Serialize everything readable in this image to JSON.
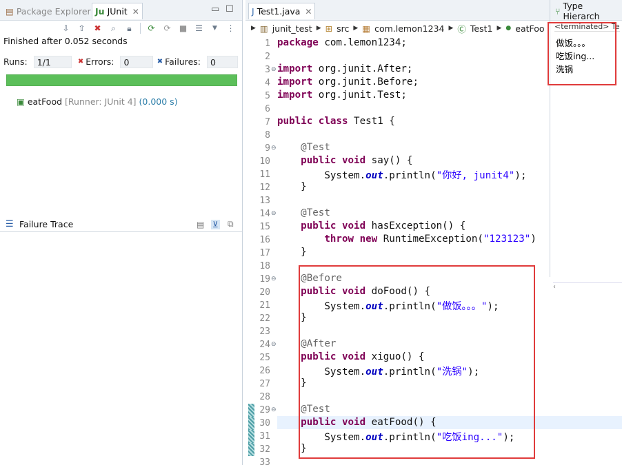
{
  "left_panel": {
    "tabs": [
      {
        "label": "Package Explorer",
        "icon": "package-icon",
        "active": false
      },
      {
        "label": "JUnit",
        "icon": "junit-icon",
        "active": true
      }
    ],
    "status_text": "Finished after 0.052 seconds",
    "runs_label": "Runs:",
    "runs_value": "1/1",
    "errors_label": "Errors:",
    "errors_value": "0",
    "failures_label": "Failures:",
    "failures_value": "0",
    "progress_color": "#5cbf5a",
    "test_name": "eatFood",
    "test_runner": "[Runner: JUnit 4]",
    "test_time": "(0.000 s)",
    "failure_trace_label": "Failure Trace"
  },
  "editor": {
    "tab_label": "Test1.java",
    "breadcrumb": [
      "junit_test",
      "src",
      "com.lemon1234",
      "Test1",
      "eatFoo"
    ],
    "lines": [
      {
        "n": "1",
        "html": "<span class='kw'>package</span> com.lemon1234;"
      },
      {
        "n": "2",
        "html": ""
      },
      {
        "n": "3",
        "html": "<span class='kw'>import</span> org.junit.After;"
      },
      {
        "n": "4",
        "html": "<span class='kw'>import</span> org.junit.Before;"
      },
      {
        "n": "5",
        "html": "<span class='kw'>import</span> org.junit.Test;"
      },
      {
        "n": "6",
        "html": ""
      },
      {
        "n": "7",
        "html": "<span class='kw'>public class</span> Test1 {"
      },
      {
        "n": "8",
        "html": ""
      },
      {
        "n": "9",
        "html": "    <span class='ann'>@Test</span>"
      },
      {
        "n": "10",
        "html": "    <span class='kw'>public void</span> say() {"
      },
      {
        "n": "11",
        "html": "        System.<span class='fld'>out</span>.println(<span class='str'>\"你好, junit4\"</span>);"
      },
      {
        "n": "12",
        "html": "    }"
      },
      {
        "n": "13",
        "html": ""
      },
      {
        "n": "14",
        "html": "    <span class='ann'>@Test</span>"
      },
      {
        "n": "15",
        "html": "    <span class='kw'>public void</span> hasException() {"
      },
      {
        "n": "16",
        "html": "        <span class='kw'>throw new</span> RuntimeException(<span class='str'>\"123123\"</span>)"
      },
      {
        "n": "17",
        "html": "    }"
      },
      {
        "n": "18",
        "html": ""
      },
      {
        "n": "19",
        "html": "    <span class='ann'>@Before</span>"
      },
      {
        "n": "20",
        "html": "    <span class='kw'>public void</span> doFood() {"
      },
      {
        "n": "21",
        "html": "        System.<span class='fld'>out</span>.println(<span class='str'>\"做饭。。。\"</span>);"
      },
      {
        "n": "22",
        "html": "    }"
      },
      {
        "n": "23",
        "html": ""
      },
      {
        "n": "24",
        "html": "    <span class='ann'>@After</span>"
      },
      {
        "n": "25",
        "html": "    <span class='kw'>public void</span> xiguo() {"
      },
      {
        "n": "26",
        "html": "        System.<span class='fld'>out</span>.println(<span class='str'>\"洗锅\"</span>);"
      },
      {
        "n": "27",
        "html": "    }"
      },
      {
        "n": "28",
        "html": ""
      },
      {
        "n": "29",
        "html": "    <span class='ann'>@Test</span>"
      },
      {
        "n": "30",
        "html": "    <span class='kw'>public void</span> eatFood() {"
      },
      {
        "n": "31",
        "html": "        System.<span class='fld'>out</span>.println(<span class='str'>\"吃饭ing...\"</span>);"
      },
      {
        "n": "32",
        "html": "    }"
      },
      {
        "n": "33",
        "html": ""
      }
    ]
  },
  "type_hierarchy": {
    "tab_label": "Type Hierarch",
    "console_header": "<terminated> Te",
    "console_lines": [
      "做饭。。。",
      "吃饭ing...",
      "洗锅"
    ]
  },
  "colors": {
    "keyword": "#7f0055",
    "string": "#2a00ff",
    "annotation": "#646464",
    "highlight_box": "#e03b3b"
  }
}
